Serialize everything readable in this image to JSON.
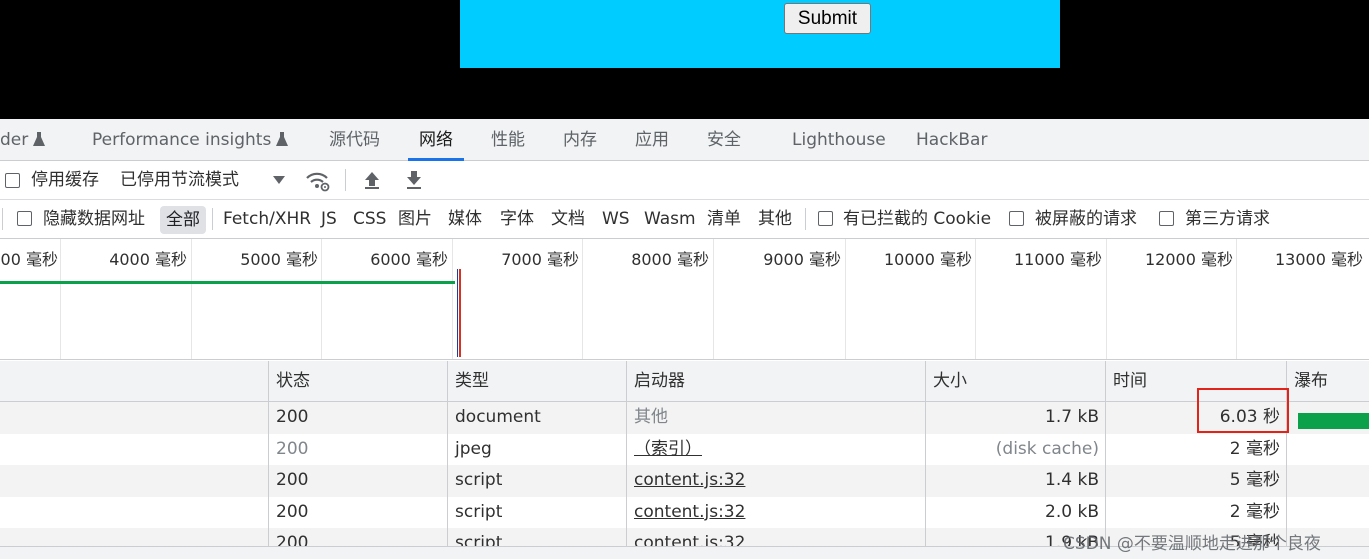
{
  "page": {
    "submit_label": "Submit"
  },
  "tabs": [
    {
      "label": "der"
    },
    {
      "label": "Performance insights"
    },
    {
      "label": "源代码"
    },
    {
      "label": "网络"
    },
    {
      "label": "性能"
    },
    {
      "label": "内存"
    },
    {
      "label": "应用"
    },
    {
      "label": "安全"
    },
    {
      "label": "Lighthouse"
    },
    {
      "label": "HackBar"
    }
  ],
  "toolbar1": {
    "disable_cache": "停用缓存",
    "throttle": "已停用节流模式"
  },
  "toolbar2": {
    "hide_data_urls": "隐藏数据网址",
    "filters": [
      "全部",
      "Fetch/XHR",
      "JS",
      "CSS",
      "图片",
      "媒体",
      "字体",
      "文档",
      "WS",
      "Wasm",
      "清单",
      "其他"
    ],
    "blocked_cookies": "有已拦截的 Cookie",
    "blocked_requests": "被屏蔽的请求",
    "third_party": "第三方请求"
  },
  "timeline": {
    "ticks": [
      "00 毫秒",
      "4000 毫秒",
      "5000 毫秒",
      "6000 毫秒",
      "7000 毫秒",
      "8000 毫秒",
      "9000 毫秒",
      "10000 毫秒",
      "11000 毫秒",
      "12000 毫秒",
      "13000 毫秒"
    ]
  },
  "table": {
    "headers": {
      "status": "状态",
      "type": "类型",
      "initiator": "启动器",
      "size": "大小",
      "time": "时间",
      "waterfall": "瀑布"
    },
    "rows": [
      {
        "status": "200",
        "type": "document",
        "initiator": "其他",
        "size": "1.7 kB",
        "time": "6.03 秒"
      },
      {
        "status": "200",
        "type": "jpeg",
        "initiator": "（索引）",
        "size": "(disk cache)",
        "time": "2 毫秒"
      },
      {
        "status": "200",
        "type": "script",
        "initiator": "content.js:32",
        "size": "1.4 kB",
        "time": "5 毫秒"
      },
      {
        "status": "200",
        "type": "script",
        "initiator": "content.js:32",
        "size": "2.0 kB",
        "time": "2 毫秒"
      },
      {
        "status": "200",
        "type": "script",
        "initiator": "content.js:32",
        "size": "1.9 kB",
        "time": "5 毫秒"
      }
    ]
  },
  "watermark": "CSDN @不要温顺地走进那个良夜"
}
